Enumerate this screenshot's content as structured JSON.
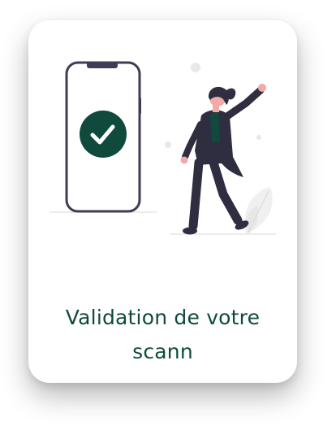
{
  "card": {
    "title_line1": "Validation de votre",
    "title_line2": "scann"
  },
  "illustration": {
    "phone": {
      "status": "check-circle-icon",
      "accent_color": "#0f4a3c"
    },
    "person": {
      "pose": "celebrating-raised-arm"
    }
  },
  "colors": {
    "text": "#0f4a3c",
    "accent": "#0f4a3c",
    "outline": "#3f3d56",
    "skin": "#f2a9a9"
  }
}
